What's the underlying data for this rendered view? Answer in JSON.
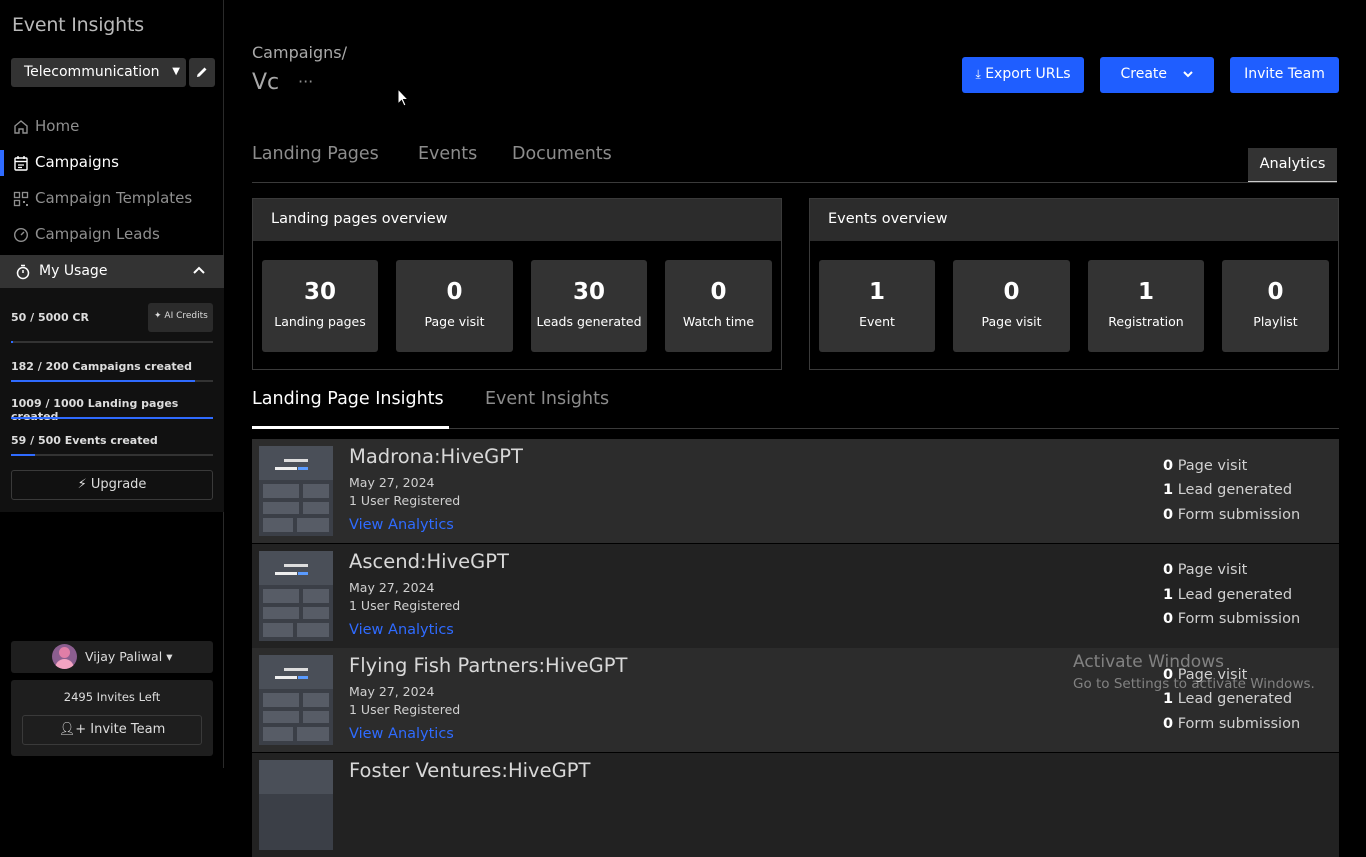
{
  "app": {
    "title": "Event Insights"
  },
  "workspace": {
    "selected": "Telecommunication"
  },
  "nav": [
    {
      "label": "Home",
      "icon": "home-icon"
    },
    {
      "label": "Campaigns",
      "icon": "calendar-icon",
      "active": true
    },
    {
      "label": "Campaign Templates",
      "icon": "qr-grid-icon"
    },
    {
      "label": "Campaign Leads",
      "icon": "gauge-icon"
    }
  ],
  "usage": {
    "title": "My Usage",
    "credits": {
      "text": "50 / 5000 CR",
      "fraction": 0.01
    },
    "ai_credits_label": "AI Credits",
    "campaigns": {
      "text": "182 / 200 Campaigns created",
      "fraction": 0.91
    },
    "landing_pages": {
      "text": "1009 / 1000 Landing pages created",
      "fraction": 1.0
    },
    "events": {
      "text": "59 / 500 Events created",
      "fraction": 0.118
    },
    "upgrade_label": "Upgrade"
  },
  "user": {
    "name": "Vijay Paliwal",
    "invites_left": "2495 Invites Left",
    "invite_label": "Invite Team"
  },
  "header": {
    "breadcrumb": "Campaigns/",
    "title": "Vc",
    "more": "···",
    "export_label": "Export URLs",
    "create_label": "Create",
    "invite_label": "Invite Team"
  },
  "tabs": [
    "Landing Pages",
    "Events",
    "Documents"
  ],
  "analytics_tab": "Analytics",
  "landing_overview": {
    "title": "Landing pages overview",
    "stats": [
      {
        "value": "30",
        "label": "Landing pages"
      },
      {
        "value": "0",
        "label": "Page visit"
      },
      {
        "value": "30",
        "label": "Leads generated"
      },
      {
        "value": "0",
        "label": "Watch time"
      }
    ]
  },
  "events_overview": {
    "title": "Events overview",
    "stats": [
      {
        "value": "1",
        "label": "Event"
      },
      {
        "value": "0",
        "label": "Page visit"
      },
      {
        "value": "1",
        "label": "Registration"
      },
      {
        "value": "0",
        "label": "Playlist"
      }
    ]
  },
  "insight_tabs": [
    "Landing Page Insights",
    "Event Insights"
  ],
  "rows": [
    {
      "title": "Madrona:HiveGPT",
      "date": "May 27, 2024",
      "registered": "1 User Registered",
      "link": "View Analytics",
      "page_visit": "0",
      "page_visit_label": "Page visit",
      "lead": "1",
      "lead_label": "Lead generated",
      "form": "0",
      "form_label": "Form submission"
    },
    {
      "title": "Ascend:HiveGPT",
      "date": "May 27, 2024",
      "registered": "1 User Registered",
      "link": "View Analytics",
      "page_visit": "0",
      "page_visit_label": "Page visit",
      "lead": "1",
      "lead_label": "Lead generated",
      "form": "0",
      "form_label": "Form submission"
    },
    {
      "title": "Flying Fish Partners:HiveGPT",
      "date": "May 27, 2024",
      "registered": "1 User Registered",
      "link": "View Analytics",
      "page_visit": "0",
      "page_visit_label": "Page visit",
      "lead": "1",
      "lead_label": "Lead generated",
      "form": "0",
      "form_label": "Form submission"
    },
    {
      "title": "Foster Ventures:HiveGPT"
    }
  ],
  "watermark": {
    "line1": "Activate Windows",
    "line2": "Go to Settings to activate Windows."
  },
  "colors": {
    "accent": "#1f5eff",
    "link": "#2f6bff",
    "panel": "#333333",
    "row_bg": "#2c2c2c"
  }
}
